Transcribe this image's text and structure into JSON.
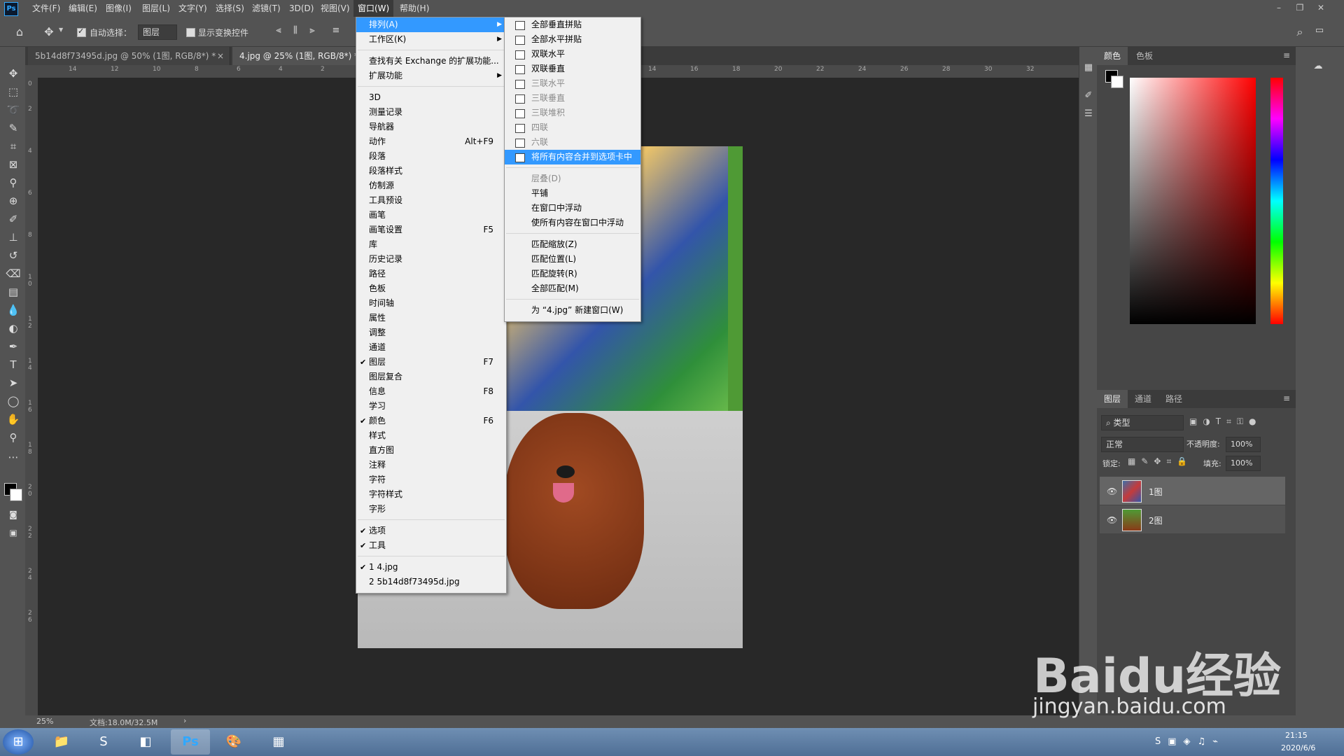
{
  "menubar": {
    "items": [
      "文件(F)",
      "编辑(E)",
      "图像(I)",
      "图层(L)",
      "文字(Y)",
      "选择(S)",
      "滤镜(T)",
      "3D(D)",
      "视图(V)",
      "窗口(W)",
      "帮助(H)"
    ],
    "logo": "Ps"
  },
  "options": {
    "auto_select_label": "自动选择：",
    "auto_select_value": "图层",
    "show_transform_label": "显示变换控件"
  },
  "tabs": [
    "5b14d8f73495d.jpg @ 50% (1图, RGB/8*) *",
    "4.jpg @ 25% (1图, RGB/8*) *"
  ],
  "ruler_top": [
    "14",
    "12",
    "10",
    "8",
    "6",
    "4",
    "2",
    "14",
    "16",
    "18",
    "20",
    "22",
    "24",
    "26",
    "28",
    "30",
    "32"
  ],
  "ruler_left": [
    "0",
    "2",
    "4",
    "6",
    "8",
    "1 0",
    "1 2",
    "1 4",
    "1 6",
    "1 8",
    "2 0",
    "2 2",
    "2 4",
    "2 6"
  ],
  "status": {
    "zoom": "25%",
    "doc": "文档:18.0M/32.5M"
  },
  "window_menu": {
    "items": [
      {
        "label": "排列(A)",
        "shortcut": "",
        "checked": false,
        "submenu": true
      },
      {
        "label": "工作区(K)",
        "shortcut": "",
        "checked": false,
        "submenu": true
      },
      {
        "label": "查找有关 Exchange 的扩展功能...",
        "shortcut": "",
        "checked": false,
        "submenu": false
      },
      {
        "label": "扩展功能",
        "shortcut": "",
        "checked": false,
        "submenu": true
      },
      {
        "label": "3D",
        "shortcut": "",
        "checked": false
      },
      {
        "label": "测量记录",
        "shortcut": "",
        "checked": false
      },
      {
        "label": "导航器",
        "shortcut": "",
        "checked": false
      },
      {
        "label": "动作",
        "shortcut": "Alt+F9",
        "checked": false
      },
      {
        "label": "段落",
        "shortcut": "",
        "checked": false
      },
      {
        "label": "段落样式",
        "shortcut": "",
        "checked": false
      },
      {
        "label": "仿制源",
        "shortcut": "",
        "checked": false
      },
      {
        "label": "工具预设",
        "shortcut": "",
        "checked": false
      },
      {
        "label": "画笔",
        "shortcut": "",
        "checked": false
      },
      {
        "label": "画笔设置",
        "shortcut": "F5",
        "checked": false
      },
      {
        "label": "库",
        "shortcut": "",
        "checked": false
      },
      {
        "label": "历史记录",
        "shortcut": "",
        "checked": false
      },
      {
        "label": "路径",
        "shortcut": "",
        "checked": false
      },
      {
        "label": "色板",
        "shortcut": "",
        "checked": false
      },
      {
        "label": "时间轴",
        "shortcut": "",
        "checked": false
      },
      {
        "label": "属性",
        "shortcut": "",
        "checked": false
      },
      {
        "label": "调整",
        "shortcut": "",
        "checked": false
      },
      {
        "label": "通道",
        "shortcut": "",
        "checked": false
      },
      {
        "label": "图层",
        "shortcut": "F7",
        "checked": true
      },
      {
        "label": "图层复合",
        "shortcut": "",
        "checked": false
      },
      {
        "label": "信息",
        "shortcut": "F8",
        "checked": false
      },
      {
        "label": "学习",
        "shortcut": "",
        "checked": false
      },
      {
        "label": "颜色",
        "shortcut": "F6",
        "checked": true
      },
      {
        "label": "样式",
        "shortcut": "",
        "checked": false
      },
      {
        "label": "直方图",
        "shortcut": "",
        "checked": false
      },
      {
        "label": "注释",
        "shortcut": "",
        "checked": false
      },
      {
        "label": "字符",
        "shortcut": "",
        "checked": false
      },
      {
        "label": "字符样式",
        "shortcut": "",
        "checked": false
      },
      {
        "label": "字形",
        "shortcut": "",
        "checked": false
      },
      {
        "label": "选项",
        "shortcut": "",
        "checked": true
      },
      {
        "label": "工具",
        "shortcut": "",
        "checked": true
      },
      {
        "label": "1 4.jpg",
        "shortcut": "",
        "checked": true
      },
      {
        "label": "2 5b14d8f73495d.jpg",
        "shortcut": "",
        "checked": false
      }
    ]
  },
  "arrange_submenu": {
    "items": [
      {
        "label": "全部垂直拼贴",
        "disabled": false
      },
      {
        "label": "全部水平拼贴",
        "disabled": false
      },
      {
        "label": "双联水平",
        "disabled": false
      },
      {
        "label": "双联垂直",
        "disabled": false
      },
      {
        "label": "三联水平",
        "disabled": true
      },
      {
        "label": "三联垂直",
        "disabled": true
      },
      {
        "label": "三联堆积",
        "disabled": true
      },
      {
        "label": "四联",
        "disabled": true
      },
      {
        "label": "六联",
        "disabled": true
      },
      {
        "label": "将所有内容合并到选项卡中",
        "disabled": false
      },
      {
        "label": "层叠(D)",
        "disabled": true
      },
      {
        "label": "平铺",
        "disabled": false
      },
      {
        "label": "在窗口中浮动",
        "disabled": false
      },
      {
        "label": "使所有内容在窗口中浮动",
        "disabled": false
      },
      {
        "label": "匹配缩放(Z)",
        "disabled": false
      },
      {
        "label": "匹配位置(L)",
        "disabled": false
      },
      {
        "label": "匹配旋转(R)",
        "disabled": false
      },
      {
        "label": "全部匹配(M)",
        "disabled": false
      },
      {
        "label": "为 “4.jpg” 新建窗口(W)",
        "disabled": false
      }
    ]
  },
  "color_panel": {
    "tabs": [
      "颜色",
      "色板"
    ]
  },
  "layers_panel": {
    "tabs": [
      "图层",
      "通道",
      "路径"
    ],
    "filter": "类型",
    "blend": "正常",
    "opacity_label": "不透明度:",
    "opacity": "100%",
    "lock_label": "锁定:",
    "fill_label": "填充:",
    "fill": "100%",
    "layers": [
      "1图",
      "2图"
    ]
  },
  "taskbar": {
    "time": "21:15",
    "date": "2020/6/6"
  },
  "watermark": {
    "brand": "Baidu经验",
    "url": "jingyan.baidu.com"
  },
  "colors": {
    "accent": "#3399ff",
    "ps_bg": "#535353",
    "canvas": "#282828"
  }
}
